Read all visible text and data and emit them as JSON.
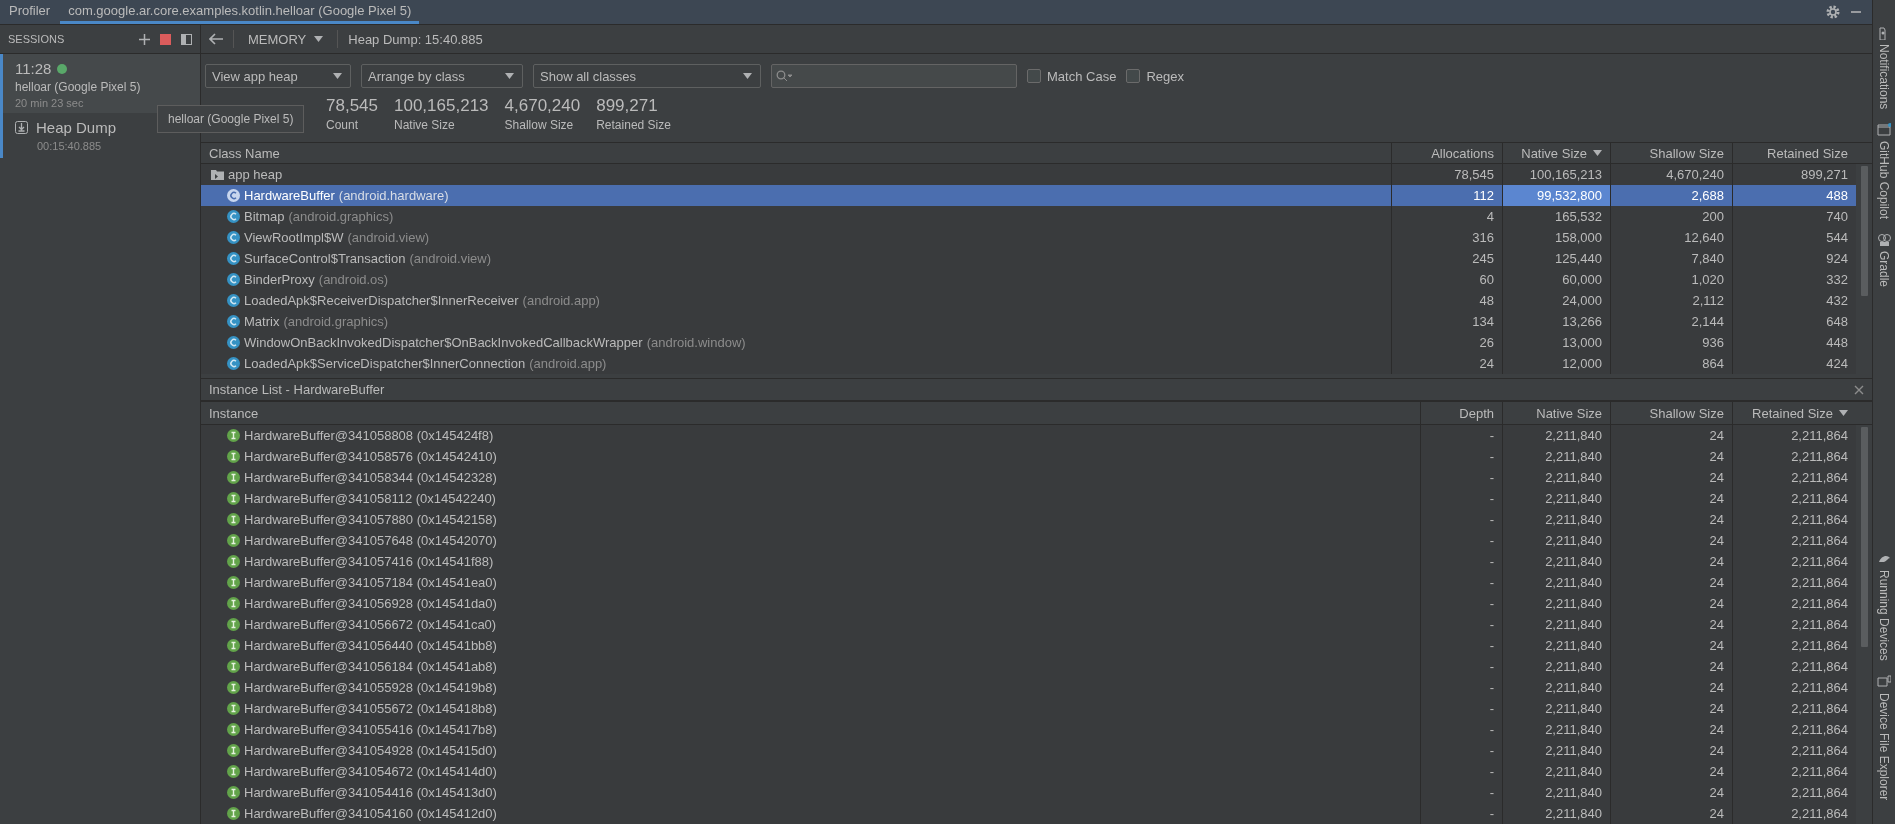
{
  "tabs": [
    {
      "label": "Profiler",
      "selected": false
    },
    {
      "label": "com.google.ar.core.examples.kotlin.helloar (Google Pixel 5)",
      "selected": true
    }
  ],
  "sessions": {
    "title": "SESSIONS",
    "items": [
      {
        "time": "11:28",
        "live": true,
        "name": "helloar (Google Pixel 5)",
        "duration": "20 min 23 sec",
        "selected": false
      }
    ],
    "artifacts": [
      {
        "title": "Heap Dump",
        "time": "00:15:40.885",
        "selected": true
      }
    ]
  },
  "tooltip": "helloar (Google Pixel 5)",
  "toolbar": {
    "profiler": "MEMORY",
    "heap_dump": "Heap Dump: 15:40.885"
  },
  "filters": {
    "dropdowns": [
      "View app heap",
      "Arrange by class",
      "Show all classes"
    ],
    "checkboxes": [
      {
        "label": "Match Case",
        "checked": false
      },
      {
        "label": "Regex",
        "checked": false
      }
    ]
  },
  "stats": [
    {
      "value": "78,545",
      "label": "Count"
    },
    {
      "value": "100,165,213",
      "label": "Native Size"
    },
    {
      "value": "4,670,240",
      "label": "Shallow Size"
    },
    {
      "value": "899,271",
      "label": "Retained Size"
    }
  ],
  "class_table": {
    "columns": [
      {
        "label": "Class Name",
        "sorted": false
      },
      {
        "label": "Allocations",
        "sorted": false
      },
      {
        "label": "Native Size",
        "sorted": true
      },
      {
        "label": "Shallow Size",
        "sorted": false
      },
      {
        "label": "Retained Size",
        "sorted": false
      }
    ],
    "rows": [
      {
        "kind": "heap",
        "class_name": "app heap",
        "allocations": "78,545",
        "native_size": "100,165,213",
        "shallow_size": "4,670,240",
        "retained_size": "899,271",
        "selected": false
      },
      {
        "kind": "class",
        "class_name": "HardwareBuffer",
        "package": "(android.hardware)",
        "allocations": "112",
        "native_size": "99,532,800",
        "shallow_size": "2,688",
        "retained_size": "488",
        "selected": true
      },
      {
        "kind": "class",
        "class_name": "Bitmap",
        "package": "(android.graphics)",
        "allocations": "4",
        "native_size": "165,532",
        "shallow_size": "200",
        "retained_size": "740",
        "selected": false
      },
      {
        "kind": "class",
        "class_name": "ViewRootImpl$W",
        "package": "(android.view)",
        "allocations": "316",
        "native_size": "158,000",
        "shallow_size": "12,640",
        "retained_size": "544",
        "selected": false
      },
      {
        "kind": "class",
        "class_name": "SurfaceControl$Transaction",
        "package": "(android.view)",
        "allocations": "245",
        "native_size": "125,440",
        "shallow_size": "7,840",
        "retained_size": "924",
        "selected": false
      },
      {
        "kind": "class",
        "class_name": "BinderProxy",
        "package": "(android.os)",
        "allocations": "60",
        "native_size": "60,000",
        "shallow_size": "1,020",
        "retained_size": "332",
        "selected": false
      },
      {
        "kind": "class",
        "class_name": "LoadedApk$ReceiverDispatcher$InnerReceiver",
        "package": "(android.app)",
        "allocations": "48",
        "native_size": "24,000",
        "shallow_size": "2,112",
        "retained_size": "432",
        "selected": false
      },
      {
        "kind": "class",
        "class_name": "Matrix",
        "package": "(android.graphics)",
        "allocations": "134",
        "native_size": "13,266",
        "shallow_size": "2,144",
        "retained_size": "648",
        "selected": false
      },
      {
        "kind": "class",
        "class_name": "WindowOnBackInvokedDispatcher$OnBackInvokedCallbackWrapper",
        "package": "(android.window)",
        "allocations": "26",
        "native_size": "13,000",
        "shallow_size": "936",
        "retained_size": "448",
        "selected": false
      },
      {
        "kind": "class",
        "class_name": "LoadedApk$ServiceDispatcher$InnerConnection",
        "package": "(android.app)",
        "allocations": "24",
        "native_size": "12,000",
        "shallow_size": "864",
        "retained_size": "424",
        "selected": false
      }
    ]
  },
  "instance_list": {
    "title": "Instance List - HardwareBuffer",
    "columns": [
      {
        "label": "Instance",
        "sorted": false
      },
      {
        "label": "Depth",
        "sorted": false
      },
      {
        "label": "Native Size",
        "sorted": false
      },
      {
        "label": "Shallow Size",
        "sorted": false
      },
      {
        "label": "Retained Size",
        "sorted": true
      }
    ],
    "rows": [
      {
        "instance": "HardwareBuffer@341058808 (0x145424f8)",
        "depth": "-",
        "native_size": "2,211,840",
        "shallow_size": "24",
        "retained_size": "2,211,864"
      },
      {
        "instance": "HardwareBuffer@341058576 (0x14542410)",
        "depth": "-",
        "native_size": "2,211,840",
        "shallow_size": "24",
        "retained_size": "2,211,864"
      },
      {
        "instance": "HardwareBuffer@341058344 (0x14542328)",
        "depth": "-",
        "native_size": "2,211,840",
        "shallow_size": "24",
        "retained_size": "2,211,864"
      },
      {
        "instance": "HardwareBuffer@341058112 (0x14542240)",
        "depth": "-",
        "native_size": "2,211,840",
        "shallow_size": "24",
        "retained_size": "2,211,864"
      },
      {
        "instance": "HardwareBuffer@341057880 (0x14542158)",
        "depth": "-",
        "native_size": "2,211,840",
        "shallow_size": "24",
        "retained_size": "2,211,864"
      },
      {
        "instance": "HardwareBuffer@341057648 (0x14542070)",
        "depth": "-",
        "native_size": "2,211,840",
        "shallow_size": "24",
        "retained_size": "2,211,864"
      },
      {
        "instance": "HardwareBuffer@341057416 (0x14541f88)",
        "depth": "-",
        "native_size": "2,211,840",
        "shallow_size": "24",
        "retained_size": "2,211,864"
      },
      {
        "instance": "HardwareBuffer@341057184 (0x14541ea0)",
        "depth": "-",
        "native_size": "2,211,840",
        "shallow_size": "24",
        "retained_size": "2,211,864"
      },
      {
        "instance": "HardwareBuffer@341056928 (0x14541da0)",
        "depth": "-",
        "native_size": "2,211,840",
        "shallow_size": "24",
        "retained_size": "2,211,864"
      },
      {
        "instance": "HardwareBuffer@341056672 (0x14541ca0)",
        "depth": "-",
        "native_size": "2,211,840",
        "shallow_size": "24",
        "retained_size": "2,211,864"
      },
      {
        "instance": "HardwareBuffer@341056440 (0x14541bb8)",
        "depth": "-",
        "native_size": "2,211,840",
        "shallow_size": "24",
        "retained_size": "2,211,864"
      },
      {
        "instance": "HardwareBuffer@341056184 (0x14541ab8)",
        "depth": "-",
        "native_size": "2,211,840",
        "shallow_size": "24",
        "retained_size": "2,211,864"
      },
      {
        "instance": "HardwareBuffer@341055928 (0x145419b8)",
        "depth": "-",
        "native_size": "2,211,840",
        "shallow_size": "24",
        "retained_size": "2,211,864"
      },
      {
        "instance": "HardwareBuffer@341055672 (0x145418b8)",
        "depth": "-",
        "native_size": "2,211,840",
        "shallow_size": "24",
        "retained_size": "2,211,864"
      },
      {
        "instance": "HardwareBuffer@341055416 (0x145417b8)",
        "depth": "-",
        "native_size": "2,211,840",
        "shallow_size": "24",
        "retained_size": "2,211,864"
      },
      {
        "instance": "HardwareBuffer@341054928 (0x145415d0)",
        "depth": "-",
        "native_size": "2,211,840",
        "shallow_size": "24",
        "retained_size": "2,211,864"
      },
      {
        "instance": "HardwareBuffer@341054672 (0x145414d0)",
        "depth": "-",
        "native_size": "2,211,840",
        "shallow_size": "24",
        "retained_size": "2,211,864"
      },
      {
        "instance": "HardwareBuffer@341054416 (0x145413d0)",
        "depth": "-",
        "native_size": "2,211,840",
        "shallow_size": "24",
        "retained_size": "2,211,864"
      },
      {
        "instance": "HardwareBuffer@341054160 (0x145412d0)",
        "depth": "-",
        "native_size": "2,211,840",
        "shallow_size": "24",
        "retained_size": "2,211,864"
      }
    ]
  },
  "side_tools": [
    "Notifications",
    "GitHub Copilot",
    "Gradle",
    "Running Devices",
    "Device File Explorer"
  ]
}
